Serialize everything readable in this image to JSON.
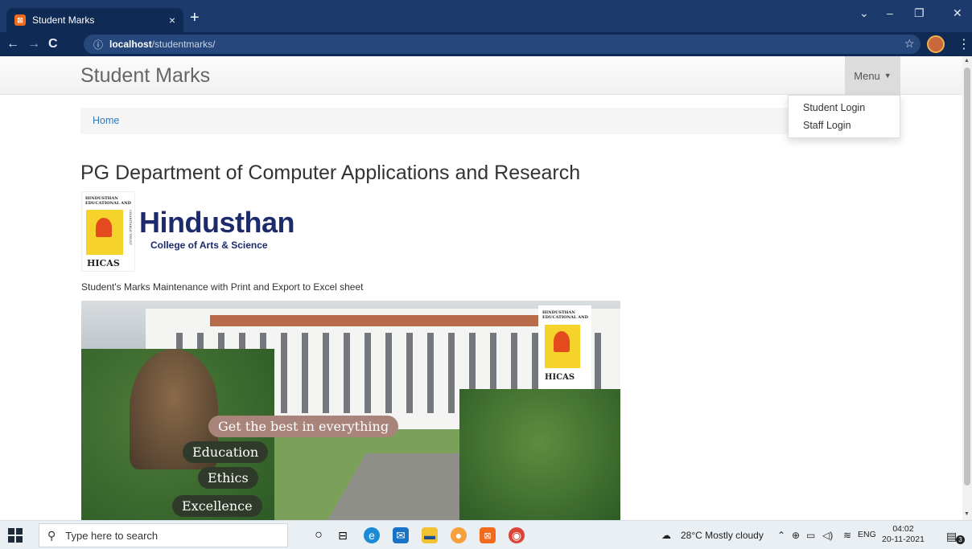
{
  "browser": {
    "tab_title": "Student Marks",
    "tab_close": "×",
    "new_tab": "+",
    "url_host": "localhost",
    "url_path": "/studentmarks/"
  },
  "site": {
    "brand": "Student Marks",
    "menu_label": "Menu",
    "dropdown": [
      "Student Login",
      "Staff Login"
    ],
    "breadcrumb": "Home",
    "dept_title": "PG Department of Computer Applications and Research",
    "logo": {
      "name": "Hindusthan",
      "subtitle": "College of Arts & Science",
      "emblem_top": "HINDUSTHAN",
      "emblem_top2": "EDUCATIONAL AND",
      "emblem_side": "CHARITABLE TRUST",
      "emblem_bottom": "HICAS"
    },
    "tagline": "Student's Marks Maintenance with Print and Export to Excel sheet",
    "photo_pills": {
      "best": "Get the best in everything",
      "education": "Education",
      "ethics": "Ethics",
      "excellence": "Excellence"
    }
  },
  "taskbar": {
    "search_placeholder": "Type here to search",
    "weather": "28°C  Mostly cloudy",
    "lang": "ENG",
    "time": "04:02",
    "date": "20-11-2021",
    "notif_count": "3"
  },
  "colors": {
    "browser_frame": "#1c3a6b",
    "link": "#337ab7",
    "logo_blue": "#1d2a6b",
    "emblem_yellow": "#f5d32a"
  }
}
